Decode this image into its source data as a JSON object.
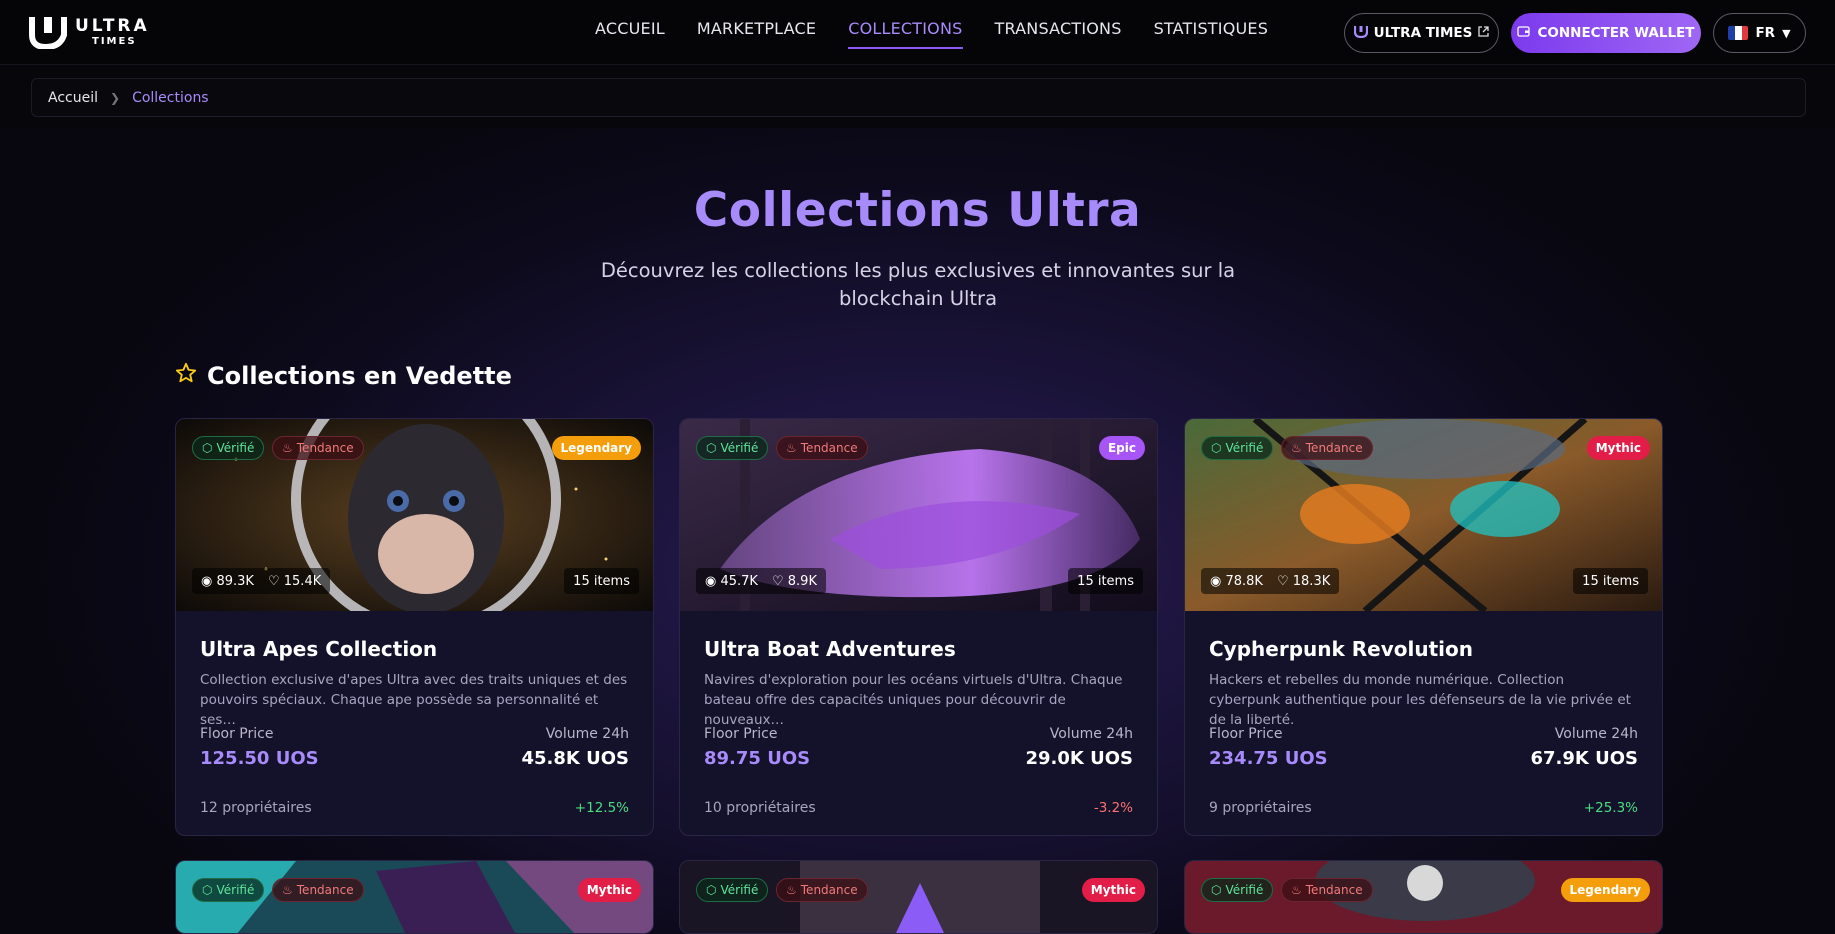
{
  "header": {
    "logo_line1": "ULTRA",
    "logo_line2": "TIMES",
    "nav": [
      "ACCUEIL",
      "MARKETPLACE",
      "COLLECTIONS",
      "TRANSACTIONS",
      "STATISTIQUES"
    ],
    "active_nav": "COLLECTIONS",
    "ultra_times_label": "ULTRA TIMES",
    "wallet_label": "CONNECTER WALLET",
    "lang_label": "FR"
  },
  "breadcrumb": {
    "home": "Accueil",
    "current": "Collections"
  },
  "hero": {
    "title": "Collections Ultra",
    "subtitle": "Découvrez les collections les plus exclusives et innovantes sur la blockchain Ultra"
  },
  "featured_title": "Collections en Vedette",
  "cards": [
    {
      "verified": "Vérifié",
      "trending": "Tendance",
      "rarity": "Legendary",
      "rarity_color": "#f59e0b",
      "views": "89.3K",
      "likes": "15.4K",
      "items": "15 items",
      "name": "Ultra Apes Collection",
      "desc": "Collection exclusive d'apes Ultra avec des traits uniques et des pouvoirs spéciaux. Chaque ape possède sa personnalité et ses…",
      "floor_label": "Floor Price",
      "floor": "125.50 UOS",
      "volume_label": "Volume 24h",
      "volume": "45.8K UOS",
      "owners": "12 propriétaires",
      "change": "+12.5%"
    },
    {
      "verified": "Vérifié",
      "trending": "Tendance",
      "rarity": "Epic",
      "rarity_color": "#a855f7",
      "views": "45.7K",
      "likes": "8.9K",
      "items": "15 items",
      "name": "Ultra Boat Adventures",
      "desc": "Navires d'exploration pour les océans virtuels d'Ultra. Chaque bateau offre des capacités uniques pour découvrir de nouveaux…",
      "floor_label": "Floor Price",
      "floor": "89.75 UOS",
      "volume_label": "Volume 24h",
      "volume": "29.0K UOS",
      "owners": "10 propriétaires",
      "change": "-3.2%"
    },
    {
      "verified": "Vérifié",
      "trending": "Tendance",
      "rarity": "Mythic",
      "rarity_color": "#e11d48",
      "views": "78.8K",
      "likes": "18.3K",
      "items": "15 items",
      "name": "Cypherpunk Revolution",
      "desc": "Hackers et rebelles du monde numérique. Collection cyberpunk authentique pour les défenseurs de la vie privée et de la liberté.",
      "floor_label": "Floor Price",
      "floor": "234.75 UOS",
      "volume_label": "Volume 24h",
      "volume": "67.9K UOS",
      "owners": "9 propriétaires",
      "change": "+25.3%"
    },
    {
      "verified": "Vérifié",
      "trending": "Tendance",
      "rarity": "Mythic",
      "rarity_color": "#e11d48"
    },
    {
      "verified": "Vérifié",
      "trending": "Tendance",
      "rarity": "Mythic",
      "rarity_color": "#e11d48"
    },
    {
      "verified": "Vérifié",
      "trending": "Tendance",
      "rarity": "Legendary",
      "rarity_color": "#f59e0b"
    }
  ]
}
